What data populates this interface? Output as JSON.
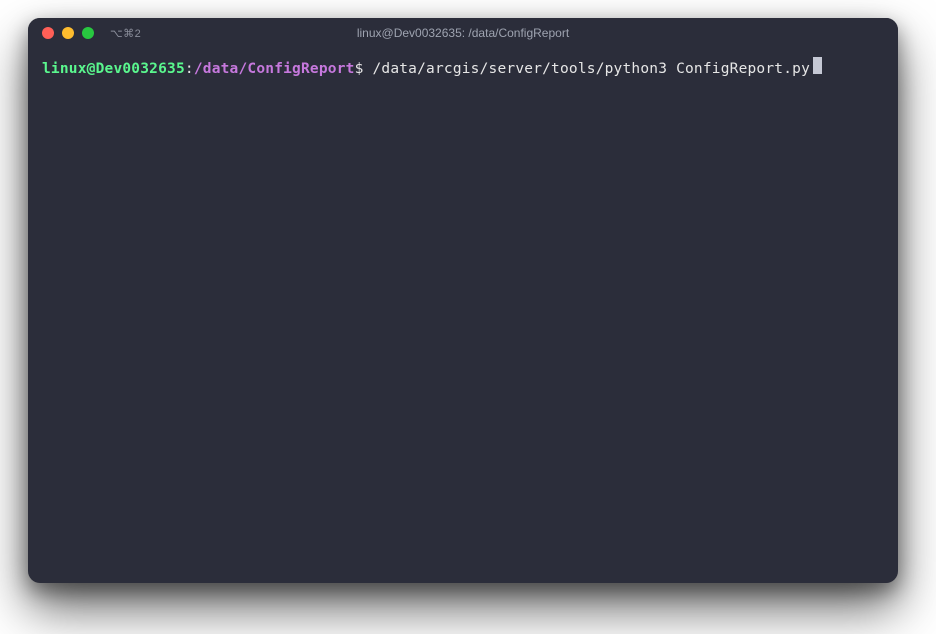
{
  "window": {
    "title": "linux@Dev0032635: /data/ConfigReport",
    "tab_indicator": "⌥⌘2"
  },
  "traffic_lights": {
    "close": "#ff5f57",
    "minimize": "#febc2e",
    "maximize": "#28c840"
  },
  "prompt": {
    "user_host": "linux@Dev0032635",
    "separator1": ":",
    "cwd": "/data/ConfigReport",
    "symbol": "$",
    "command": "/data/arcgis/server/tools/python3 ConfigReport.py"
  }
}
